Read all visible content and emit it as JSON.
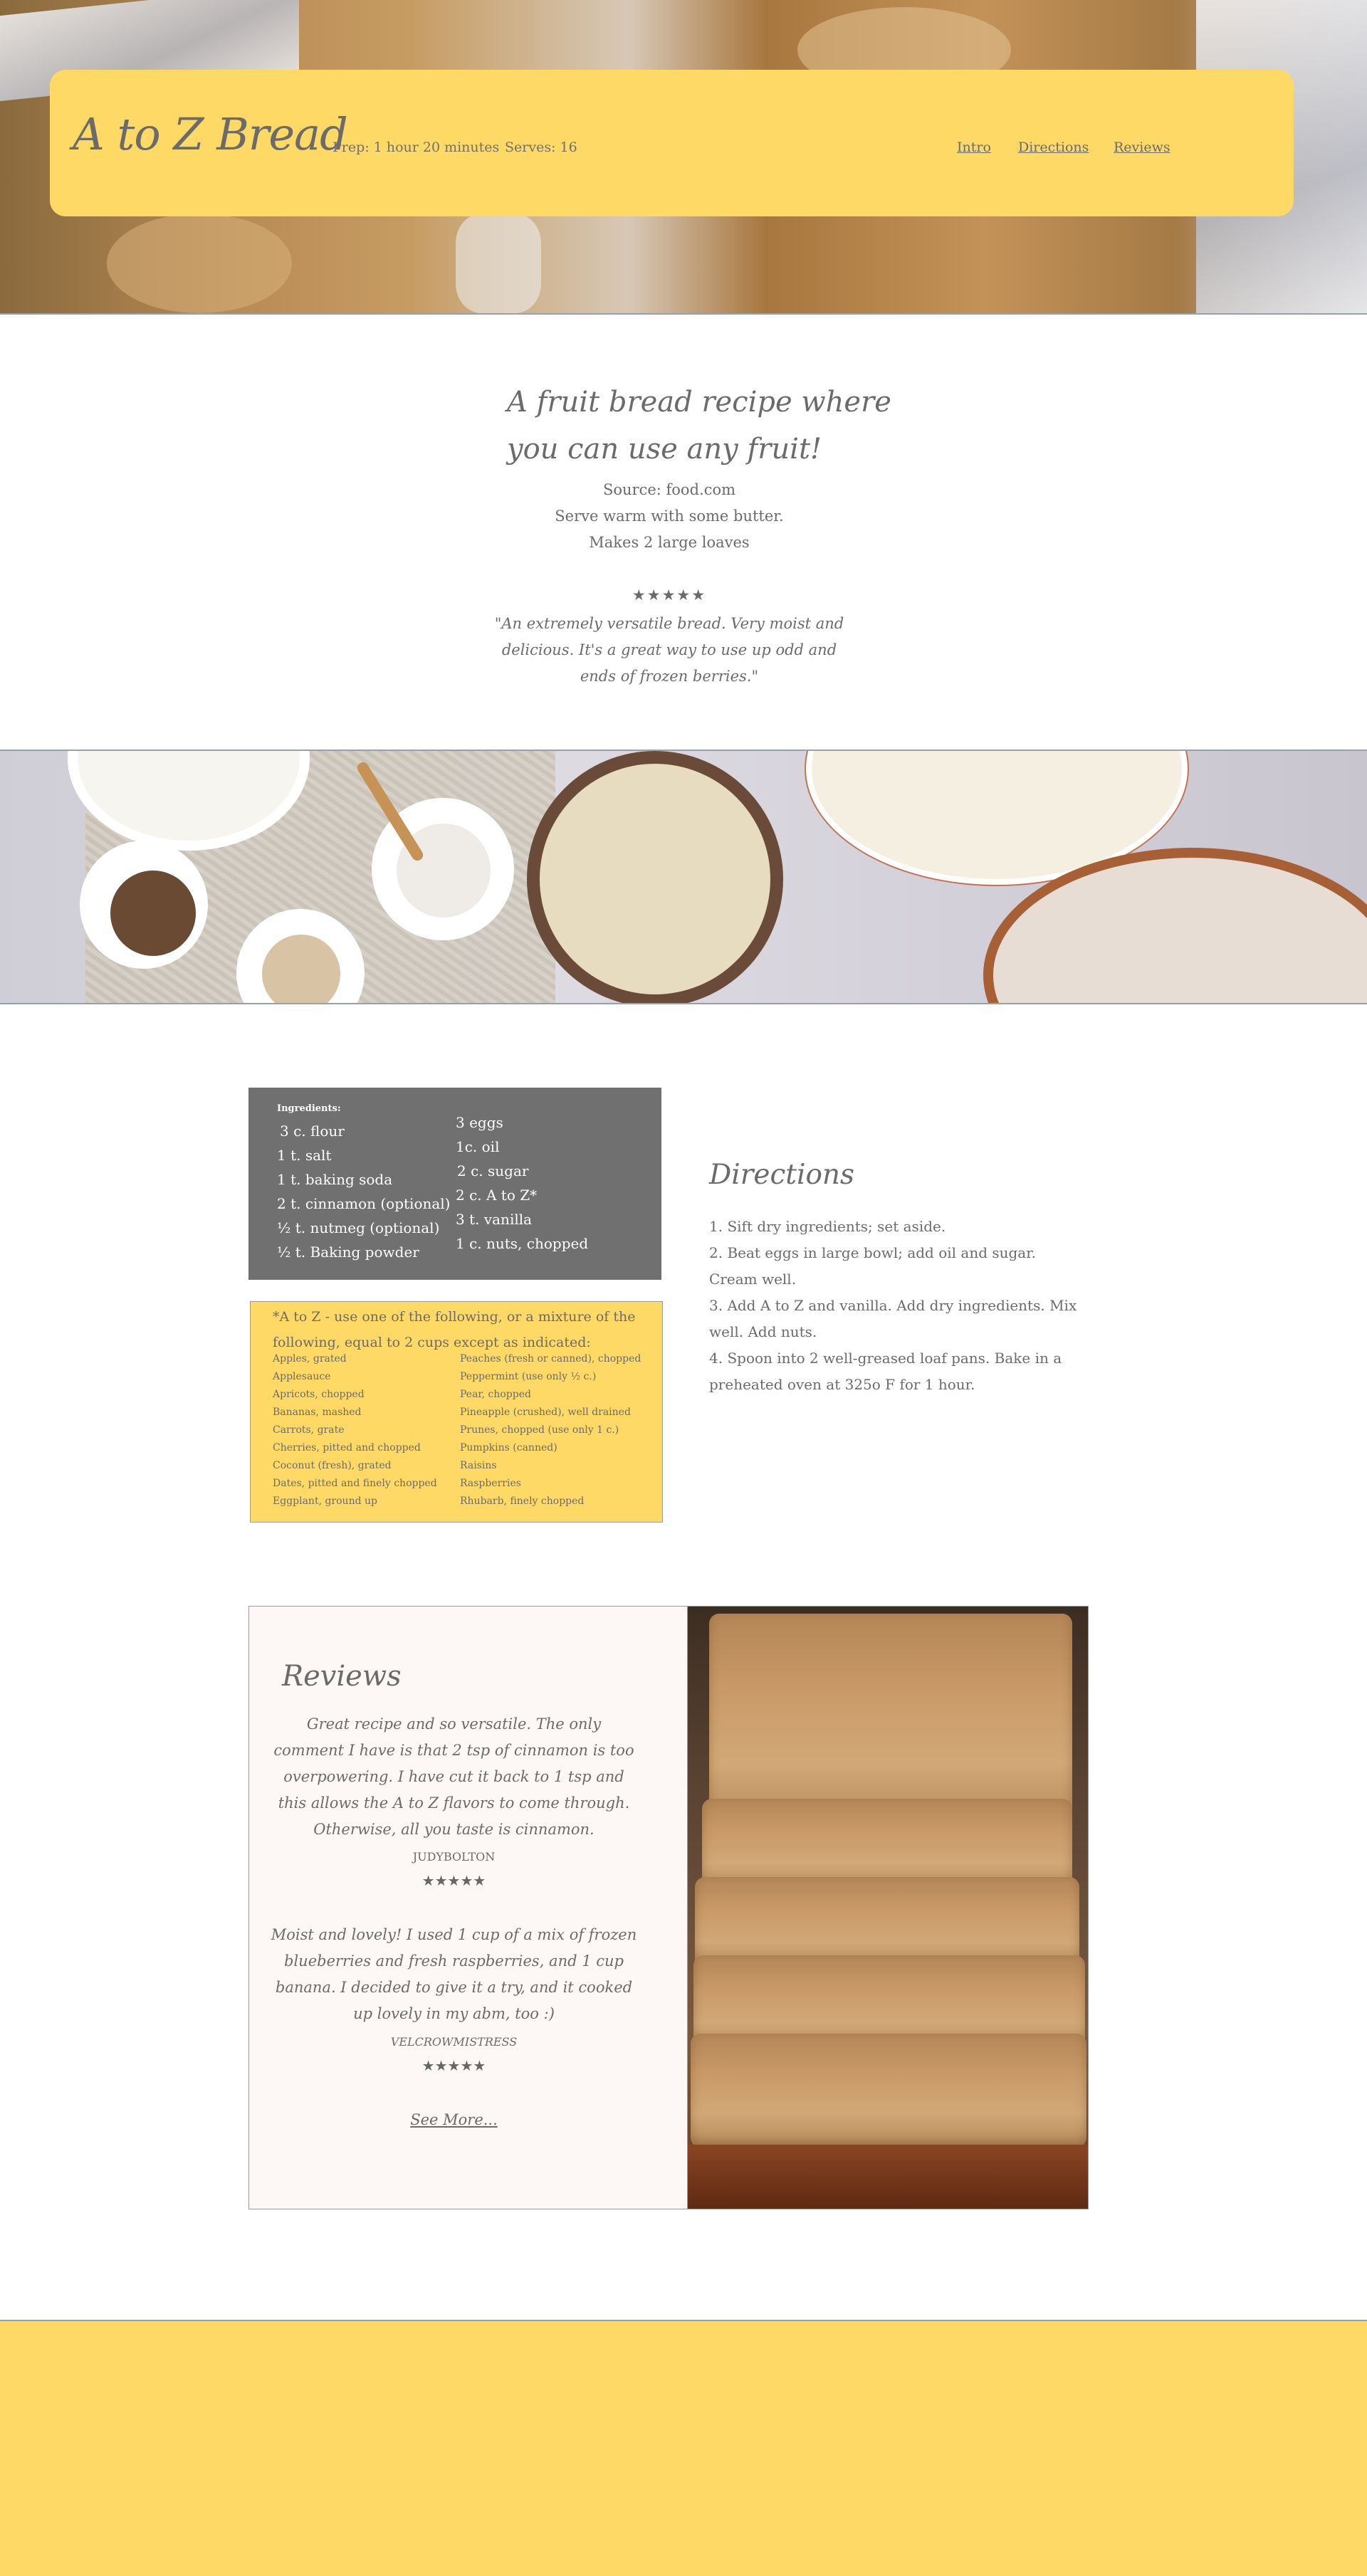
{
  "header": {
    "title": "A to Z Bread",
    "prep": "Prep: 1 hour 20 minutes",
    "serves": "Serves: 16",
    "nav": [
      "Intro",
      "Directions",
      "Reviews"
    ]
  },
  "intro": {
    "heading_line1": "A fruit bread recipe where",
    "heading_line2": "you can use any fruit!",
    "source": "Source: food.com",
    "serve": "Serve warm with some butter.",
    "makes": "Makes 2 large loaves",
    "rating": "★★★★★",
    "quote": "\"An extremely versatile bread. Very moist and delicious. It's a great way to use up odd and ends of frozen berries.\""
  },
  "ingredients": {
    "title": "Ingredients:",
    "col1": [
      "3 c. flour",
      "1 t. salt",
      "1 t. baking soda",
      "2 t. cinnamon (optional)",
      "½ t. nutmeg  (optional)",
      "½ t. Baking powder"
    ],
    "col2": [
      "3 eggs",
      "1c. oil",
      "2 c. sugar",
      "2 c. A to Z*",
      "3 t. vanilla",
      "1 c. nuts, chopped"
    ]
  },
  "a_to_z": {
    "intro": "*A to Z - use one of the following, or a mixture of the following, equal to 2 cups except as indicated:",
    "col1": [
      "Apples, grated",
      "Applesauce",
      "Apricots, chopped",
      "Bananas, mashed",
      "Carrots, grate",
      "Cherries, pitted and chopped",
      "Coconut (fresh), grated",
      "Dates, pitted and finely chopped",
      "Eggplant, ground up"
    ],
    "col2": [
      "Peaches (fresh or canned), chopped",
      "Peppermint (use only ½ c.)",
      "Pear, chopped",
      "Pineapple (crushed), well drained",
      "Prunes, chopped (use only 1 c.)",
      "Pumpkins (canned)",
      "Raisins",
      "Raspberries",
      "Rhubarb, finely chopped"
    ]
  },
  "directions": {
    "heading": "Directions",
    "steps": [
      "1. Sift dry ingredients; set aside.",
      "2. Beat eggs in large bowl; add oil and sugar. Cream well.",
      "3. Add A to Z and vanilla. Add dry ingredients. Mix well. Add nuts.",
      "4. Spoon into 2 well-greased loaf pans. Bake in a preheated oven at 325o F for 1 hour."
    ]
  },
  "reviews": {
    "heading": "Reviews",
    "items": [
      {
        "text": "Great recipe and so versatile. The only comment I have is that 2 tsp of cinnamon is too overpowering. I have cut it back to 1 tsp and this allows the A to Z flavors to come through. Otherwise, all you taste is cinnamon.",
        "author": "JUDYBOLTON",
        "rating": "★★★★★"
      },
      {
        "text": "Moist and lovely! I used 1 cup of a mix of frozen blueberries and fresh raspberries, and 1 cup banana. I decided to give it a try, and it cooked up lovely in my abm, too :)",
        "author": "VELCROWMISTRESS",
        "rating": "★★★★★"
      }
    ],
    "see_more": "See More..."
  },
  "colors": {
    "accent_yellow": "#ffd966",
    "text_gray": "#6b6b6b",
    "ingredient_box": "#707070",
    "review_bg": "#fdf8f6"
  }
}
